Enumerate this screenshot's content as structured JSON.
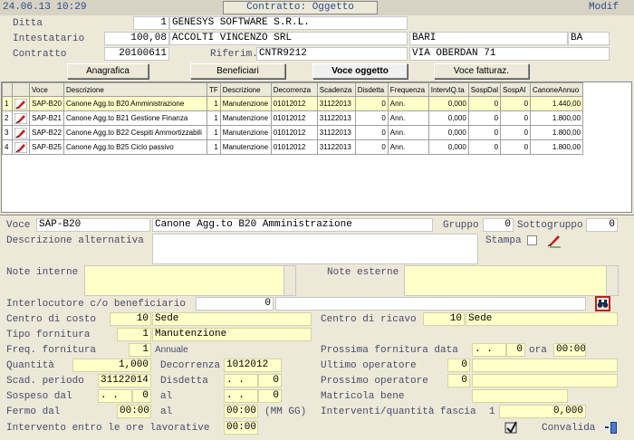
{
  "header": {
    "datetime": "24.06.13 10:29",
    "title": "Contratto: Oggetto",
    "mode": "Modif"
  },
  "top": {
    "ditta_label": "Ditta",
    "ditta_code": "1",
    "ditta_name": "GENESYS SOFTWARE S.R.L.",
    "intestatario_label": "Intestatario",
    "intestatario_code": "100,08",
    "intestatario_name": "ACCOLTI VINCENZO SRL",
    "intestatario_city": "BARI",
    "intestatario_prov": "BA",
    "contratto_label": "Contratto",
    "contratto_value": "20100611",
    "riferim_label": "Riferim.",
    "riferim_value": "CNTR9212",
    "address": "VIA OBERDAN 71"
  },
  "tabs": [
    {
      "label": "Anagrafica"
    },
    {
      "label": "Beneficiari"
    },
    {
      "label": "Voce oggetto",
      "active": true
    },
    {
      "label": "Voce fatturaz."
    }
  ],
  "grid": {
    "headers": [
      "",
      "",
      "Voce",
      "Descrizione",
      "TF",
      "Descrizione",
      "Decorrenza",
      "Scadenza",
      "Disdetta",
      "Frequenza",
      "IntervlQ.ta",
      "SospDal",
      "SospAl",
      "CanoneAnnuo"
    ],
    "rows": [
      [
        "1",
        "SAP-B20",
        "Canone Agg.to B20 Amministrazione",
        "1",
        "Manutenzione",
        "01012012",
        "31122013",
        "0",
        "Ann.",
        "0,000",
        "0",
        "0",
        "1.440,00"
      ],
      [
        "2",
        "SAP-B21",
        "Canone Agg.to B21 Gestione Finanza",
        "1",
        "Manutenzione",
        "01012012",
        "31122013",
        "0",
        "Ann.",
        "0,000",
        "0",
        "0",
        "1.800,00"
      ],
      [
        "3",
        "SAP-B22",
        "Canone Agg.to B22 Cespiti Ammortizzabili",
        "1",
        "Manutenzione",
        "01012012",
        "31122013",
        "0",
        "Ann.",
        "0,000",
        "0",
        "0",
        "1.800,00"
      ],
      [
        "4",
        "SAP-B25",
        "Canone Agg.to B25 Ciclo passivo",
        "1",
        "Manutenzione",
        "01012012",
        "31122013",
        "0",
        "Ann.",
        "0,000",
        "0",
        "0",
        "1.800,00"
      ]
    ]
  },
  "detail": {
    "voce_label": "Voce",
    "voce_code": "SAP-B20",
    "voce_desc": "Canone Agg.to B20 Amministrazione",
    "gruppo_label": "Gruppo",
    "gruppo_value": "0",
    "sottogruppo_label": "Sottogruppo",
    "sottogruppo_value": "0",
    "desc_alt_label": "Descrizione alternativa",
    "stampa_label": "Stampa",
    "note_interne_label": "Note interne",
    "note_esterne_label": "Note esterne",
    "interlocutore_label": "Interlocutore c/o beneficiario",
    "interlocutore_value": "0",
    "centro_costo_label": "Centro di costo",
    "centro_costo_code": "10",
    "centro_costo_desc": "Sede",
    "centro_ricavo_label": "Centro di ricavo",
    "centro_ricavo_code": "10",
    "centro_ricavo_desc": "Sede",
    "tipo_fornitura_label": "Tipo fornitura",
    "tipo_fornitura_code": "1",
    "tipo_fornitura_desc": "Manutenzione",
    "freq_fornitura_label": "Freq. fornitura",
    "freq_fornitura_code": "1",
    "freq_fornitura_desc": "Annuale",
    "prossima_fornitura_label": "Prossima fornitura data",
    "prossima_fornitura_date": ". .",
    "prossima_fornitura_value": "0",
    "ora_label": "ora",
    "ora_value": "00:00",
    "quantita_label": "Quantità",
    "quantita_value": "1,000",
    "decorrenza_label": "Decorrenza",
    "decorrenza_value": "1012012",
    "ultimo_operatore_label": "Ultimo   operatore",
    "ultimo_operatore_value": "0",
    "scad_periodo_label": "Scad. periodo",
    "scad_periodo_value": "31122014",
    "disdetta_label": "Disdetta",
    "disdetta_date": ". .",
    "disdetta_value": "0",
    "prossimo_operatore_label": "Prossimo  operatore",
    "prossimo_operatore_value": "0",
    "sospeso_dal_label": "Sospeso dal",
    "sospeso_dal_date": ". .",
    "sospeso_dal_value": "0",
    "al_label": "al",
    "sospeso_al_date": ". .",
    "sospeso_al_value": "0",
    "matricola_label": "Matricola bene",
    "fermo_dal_label": "Fermo    dal",
    "fermo_dal_value": "00:00",
    "fermo_al_label": "al",
    "fermo_al_value": "00:00",
    "mm_gg_label": "(MM GG)",
    "interventi_label": "Interventi/quantità fascia",
    "interventi_fascia": "1",
    "interventi_value": "0,000",
    "intervento_ore_label": "Intervento entro le ore lavorative",
    "intervento_ore_value": "00:00",
    "convalida_label": "Convalida"
  },
  "colors": {
    "field_yellow": "#ffffc8",
    "title_blue": "#2a4a8a",
    "selected_row": "#ffffc8",
    "pencil_red": "#c02020"
  }
}
